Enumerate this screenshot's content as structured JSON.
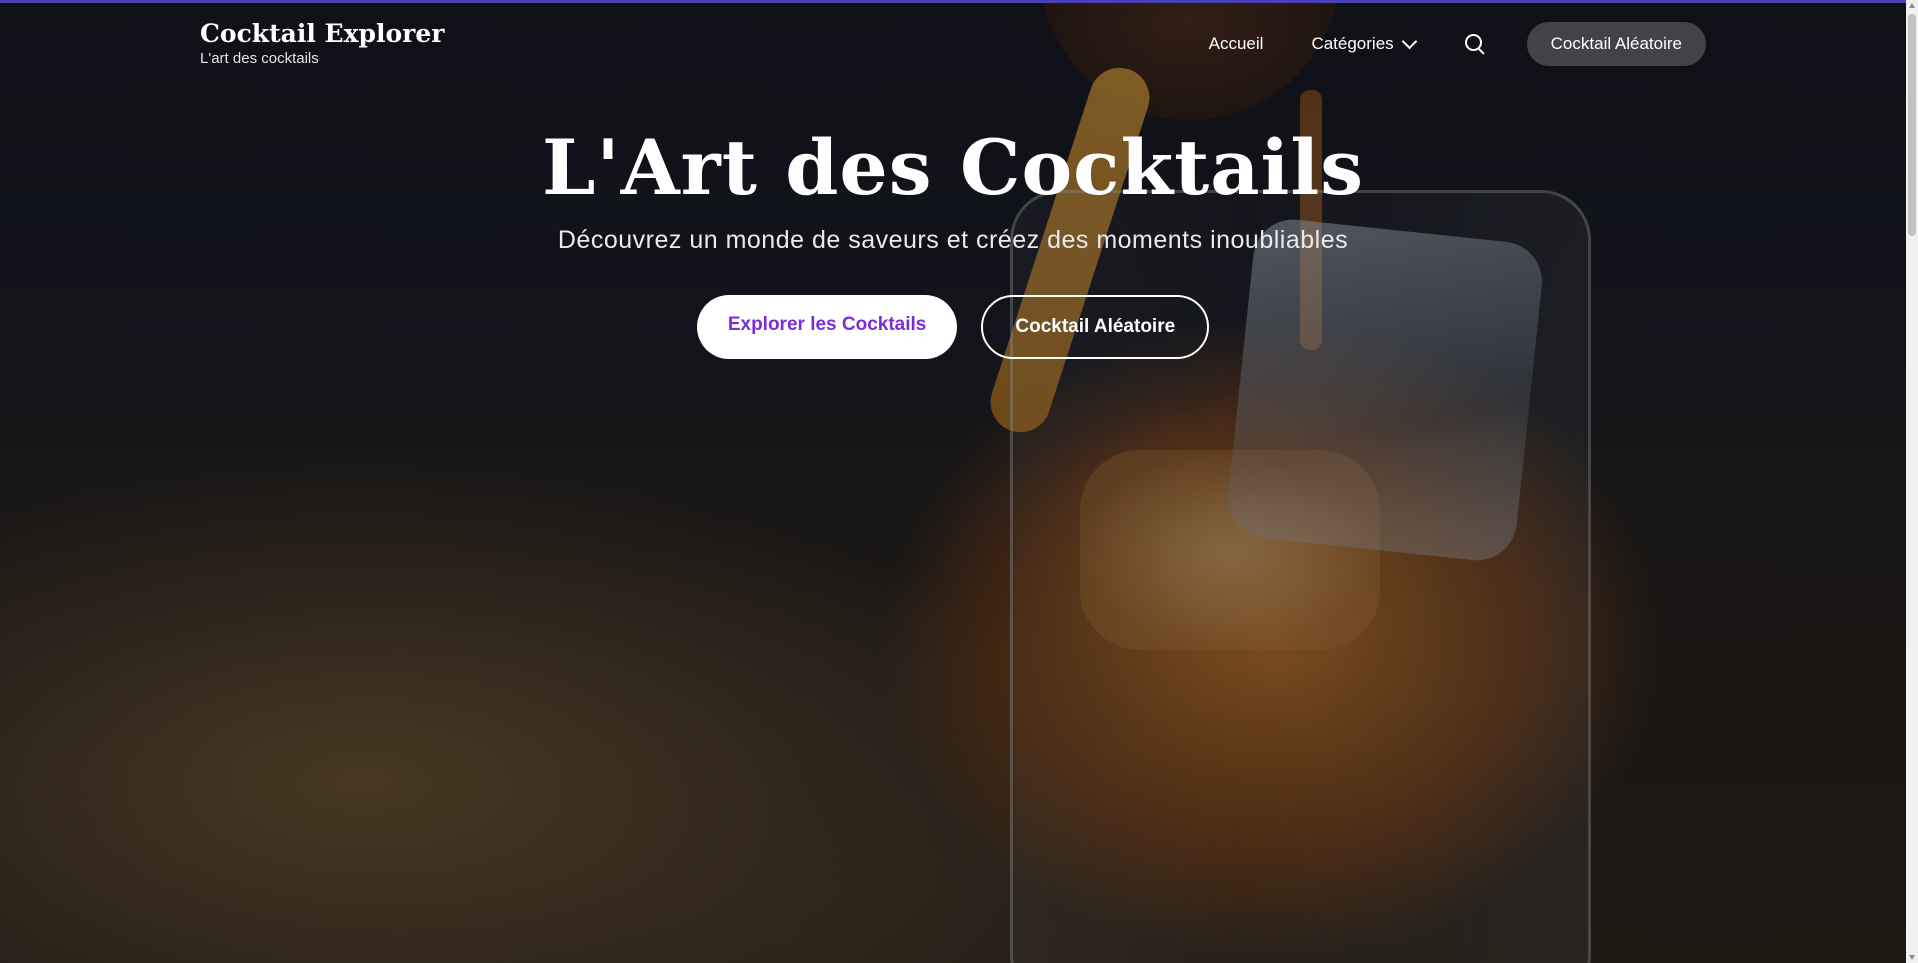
{
  "header": {
    "brand_title": "Cocktail Explorer",
    "brand_subtitle": "L'art des cocktails",
    "nav": {
      "home_label": "Accueil",
      "categories_label": "Catégories",
      "search_icon": "search-icon",
      "random_label": "Cocktail Aléatoire"
    }
  },
  "hero": {
    "title": "L'Art des Cocktails",
    "subtitle": "Découvrez un monde de saveurs et créez des moments inoubliables",
    "primary_button": "Explorer les Cocktails",
    "secondary_button": "Cocktail Aléatoire",
    "background_image": "cocktail-pouring-photo"
  },
  "colors": {
    "accent": "#7a2fd6",
    "top_border": "#4b3fb5",
    "nav_cta_bg": "#46464c",
    "text_light": "#ffffff"
  }
}
